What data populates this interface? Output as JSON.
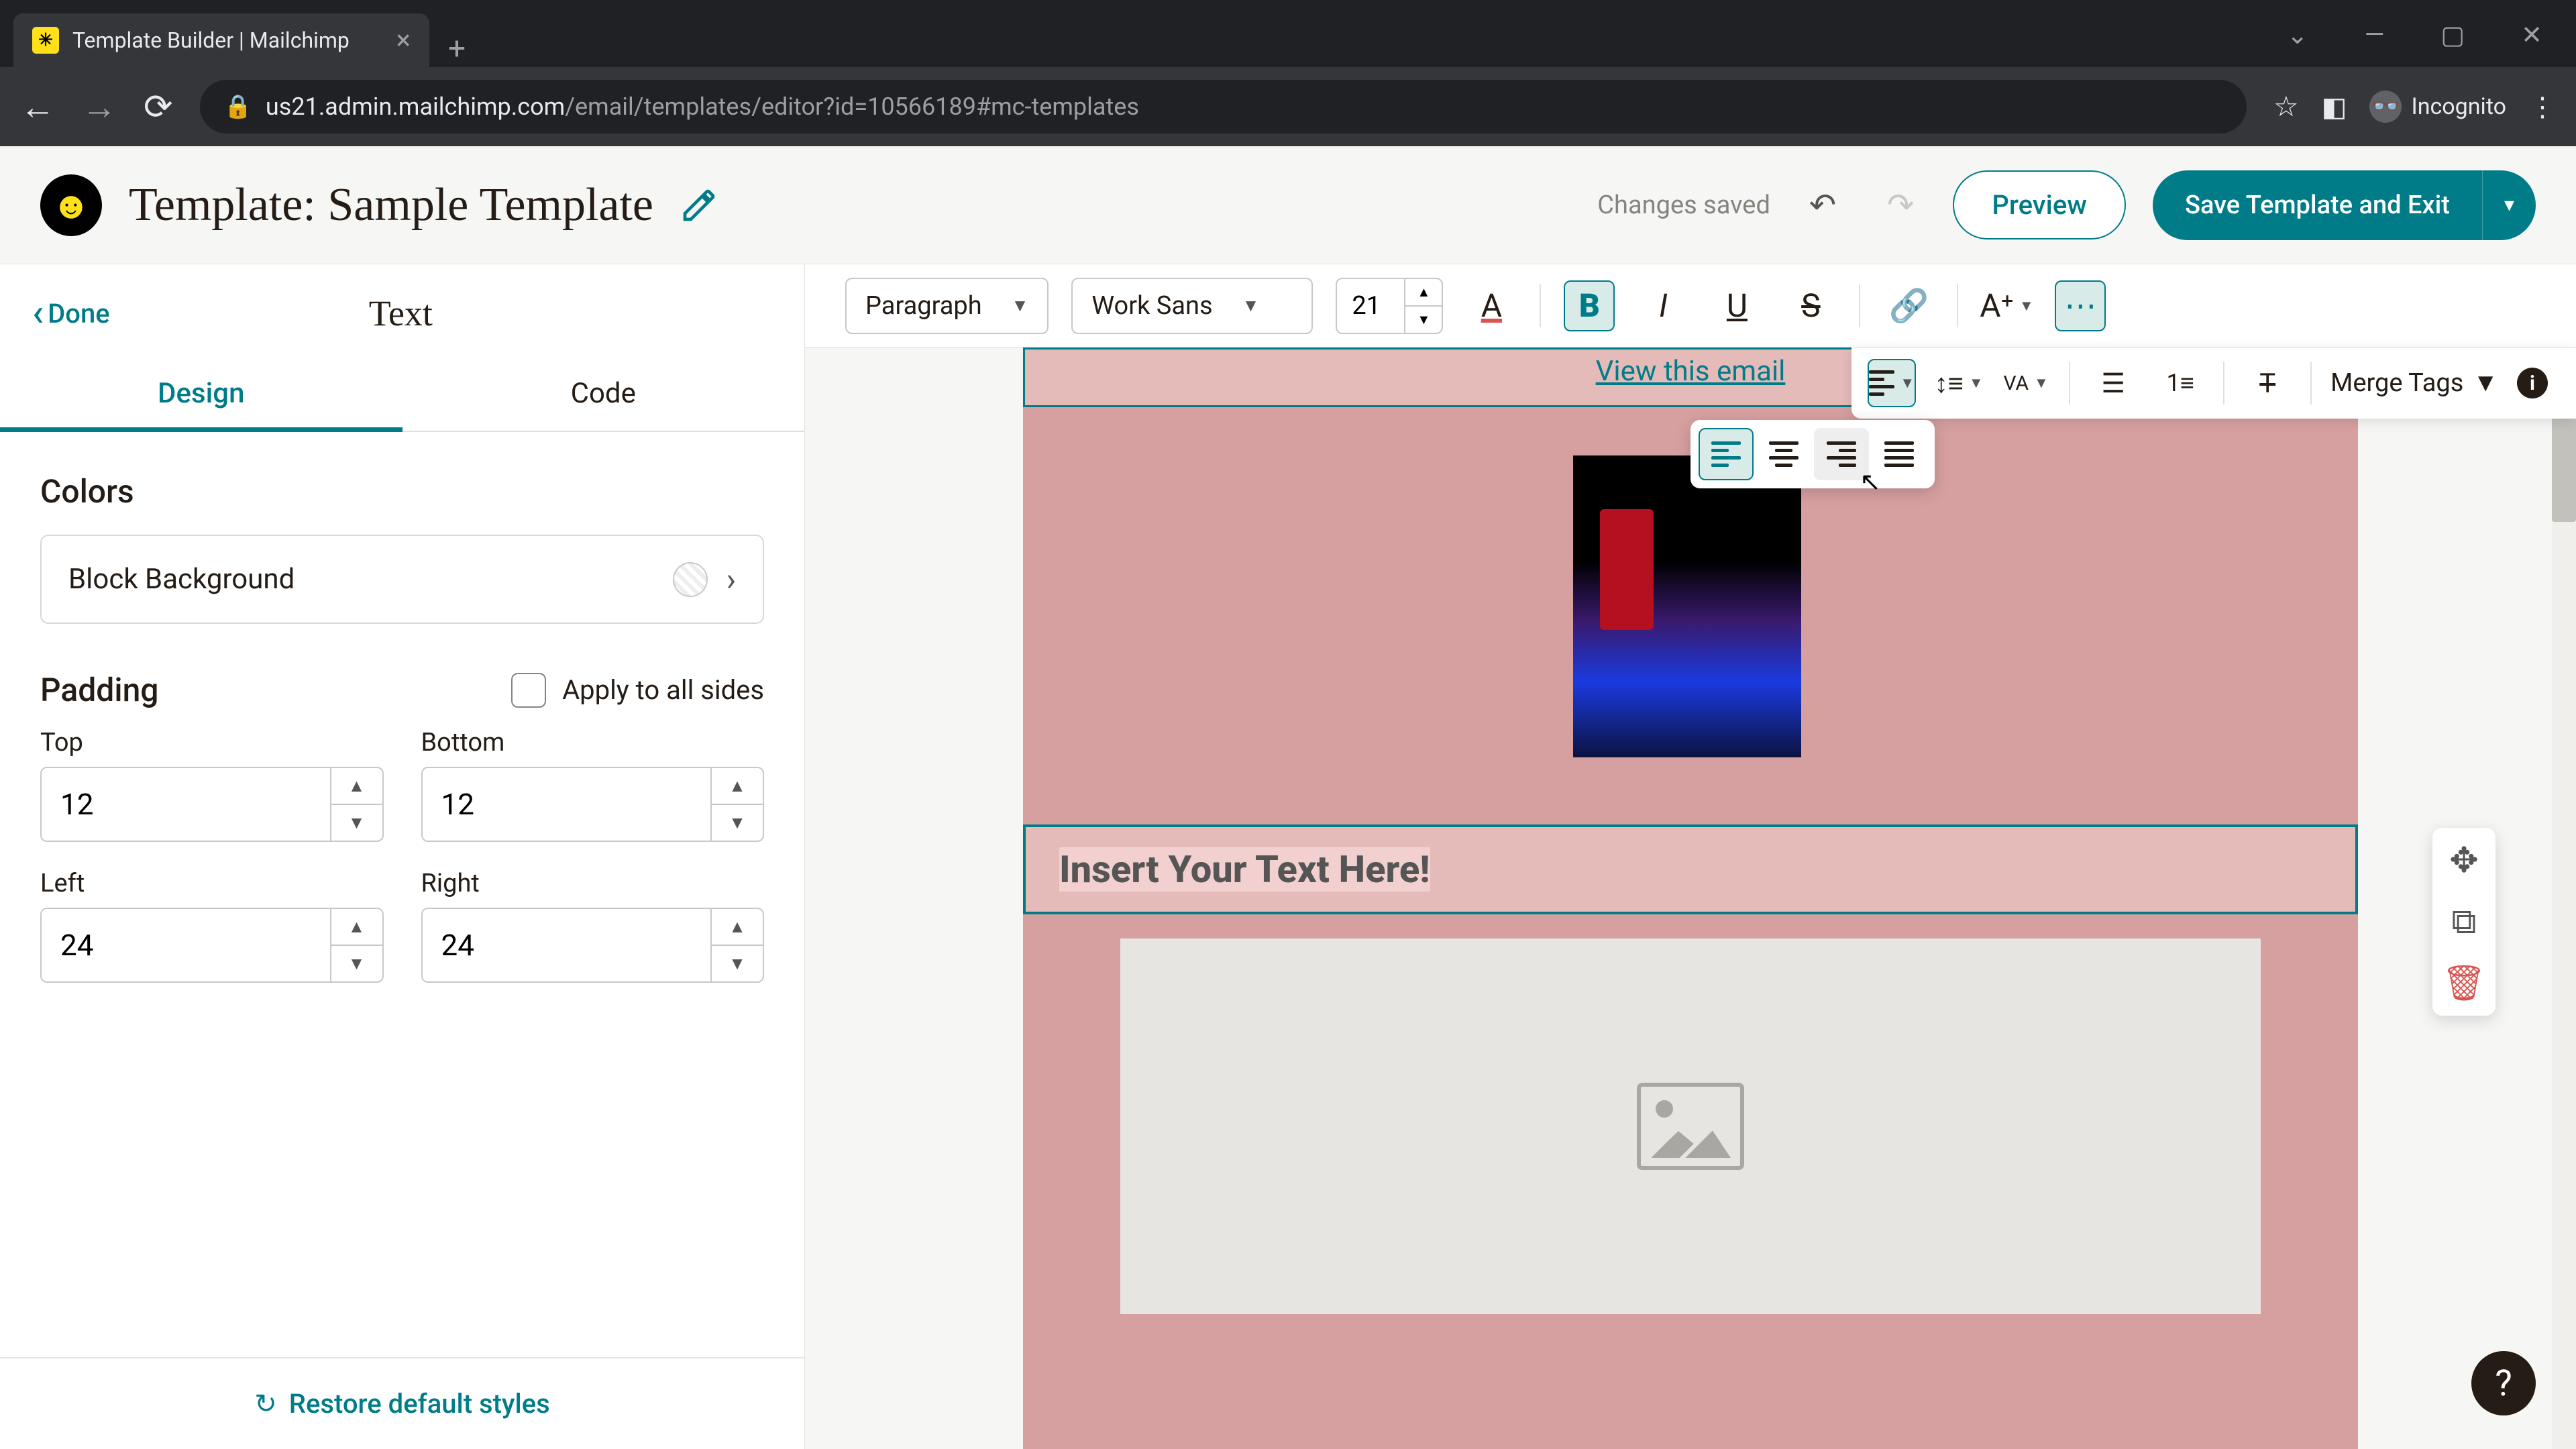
{
  "browser": {
    "tab_title": "Template Builder | Mailchimp",
    "url_host": "us21.admin.mailchimp.com",
    "url_path": "/email/templates/editor?id=10566189#mc-templates",
    "incognito_label": "Incognito"
  },
  "header": {
    "title": "Template: Sample Template",
    "status": "Changes saved",
    "preview": "Preview",
    "save": "Save Template and Exit"
  },
  "sidebar": {
    "done": "Done",
    "panel_title": "Text",
    "tabs": {
      "design": "Design",
      "code": "Code"
    },
    "colors": {
      "heading": "Colors",
      "block_background": "Block Background"
    },
    "padding": {
      "heading": "Padding",
      "apply_all": "Apply to all sides",
      "top_label": "Top",
      "top_value": "12",
      "bottom_label": "Bottom",
      "bottom_value": "12",
      "left_label": "Left",
      "left_value": "24",
      "right_label": "Right",
      "right_value": "24"
    },
    "restore": "Restore default styles"
  },
  "rte": {
    "block_format": "Paragraph",
    "font_family": "Work Sans",
    "font_size": "21",
    "merge_tags": "Merge Tags"
  },
  "canvas": {
    "view_link": "View this email",
    "text_block": "Insert Your Text Here!"
  }
}
